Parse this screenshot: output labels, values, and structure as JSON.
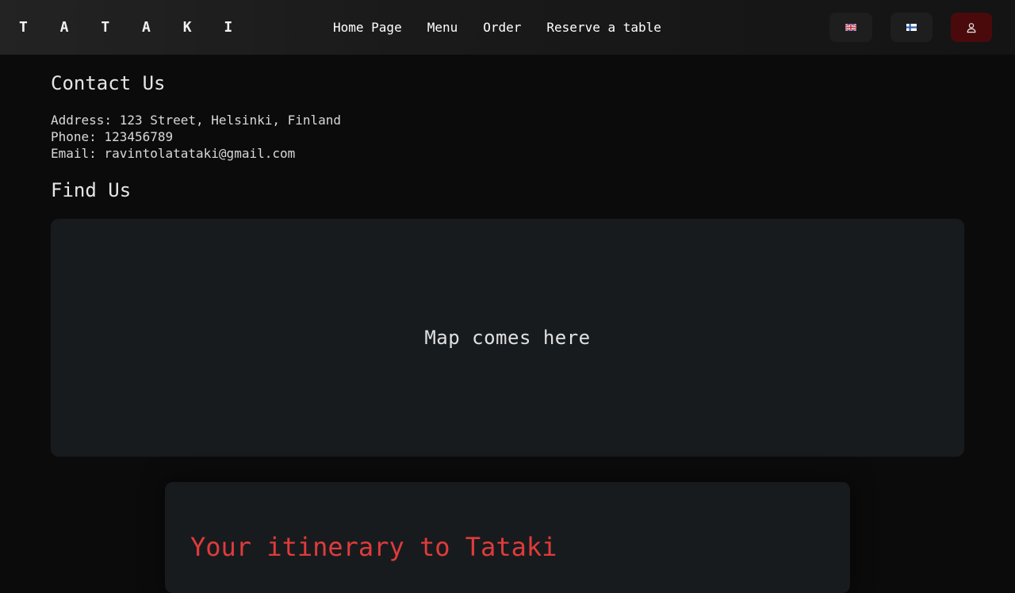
{
  "nav": {
    "brand": "T A T A K I",
    "links": [
      "Home Page",
      "Menu",
      "Order",
      "Reserve a table"
    ],
    "lang_en_icon": "uk-flag-icon",
    "lang_fi_icon": "finland-flag-icon",
    "user_icon": "user-icon"
  },
  "contact": {
    "title": "Contact Us",
    "address": "Address: 123 Street, Helsinki, Finland",
    "phone": "Phone: 123456789",
    "email": "Email: ravintolatataki@gmail.com"
  },
  "find": {
    "title": "Find Us",
    "map_placeholder": "Map comes here"
  },
  "itinerary": {
    "title": "Your itinerary to Tataki"
  },
  "colors": {
    "accent": "#e03b3b",
    "user_button": "#4a0a0c",
    "background": "#0c0b0c",
    "card": "#181b1e"
  }
}
